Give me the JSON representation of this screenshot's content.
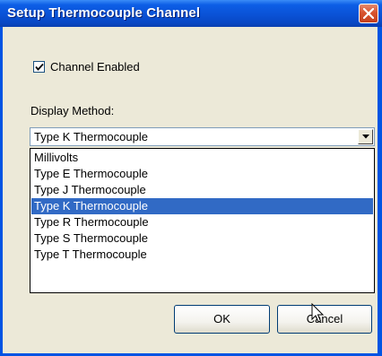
{
  "window": {
    "title": "Setup Thermocouple Channel"
  },
  "channel_enabled": {
    "label": "Channel Enabled",
    "checked": true
  },
  "display_method": {
    "label": "Display Method:",
    "selected_value": "Type K Thermocouple",
    "options": [
      "Millivolts",
      "Type E Thermocouple",
      "Type J Thermocouple",
      "Type K Thermocouple",
      "Type R Thermocouple",
      "Type S Thermocouple",
      "Type T Thermocouple"
    ],
    "highlighted_index": 3
  },
  "buttons": {
    "ok_label": "OK",
    "cancel_label": "Cancel"
  },
  "colors": {
    "title_bar": "#0a52d6",
    "highlight": "#316ac5",
    "close_button": "#d8532e",
    "dialog_face": "#ece9d8"
  }
}
